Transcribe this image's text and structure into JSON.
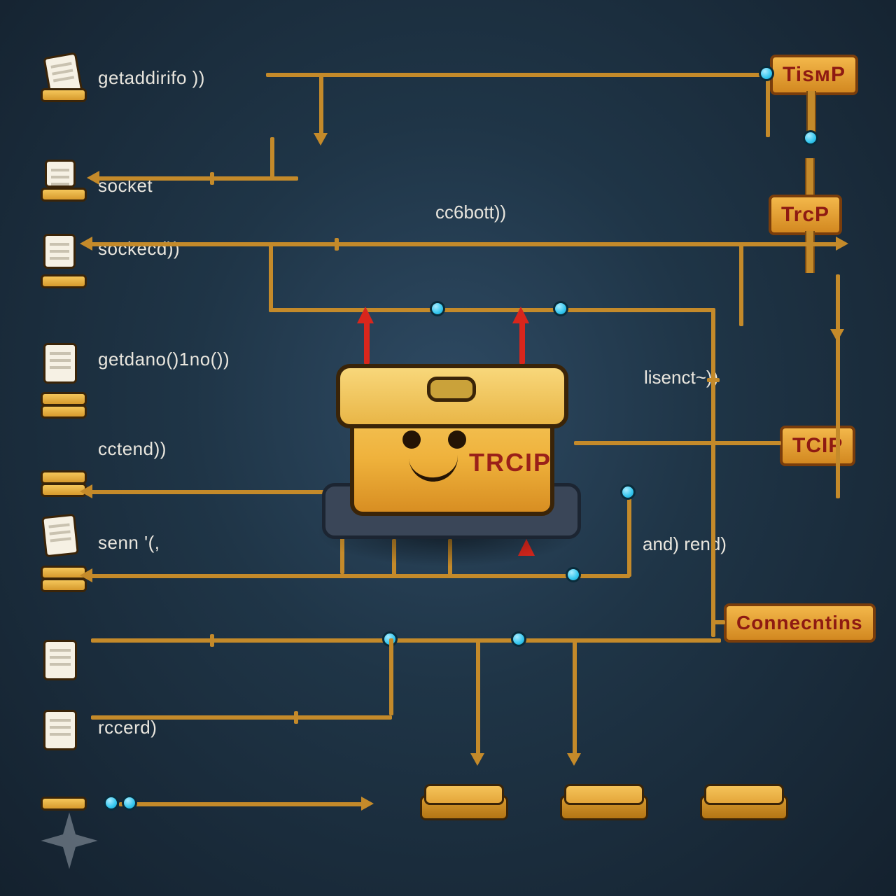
{
  "left_items": [
    {
      "label": "getaddirifo ))",
      "kind": "paper-stack"
    },
    {
      "label": "socket",
      "kind": "disc"
    },
    {
      "label": "sockecd))",
      "kind": "page-slab"
    },
    {
      "label": "getdano()1no())",
      "kind": "page-stack"
    },
    {
      "label": "cctend))",
      "kind": "stack"
    },
    {
      "label": "senn '(,",
      "kind": "paper-stack"
    },
    {
      "label": "",
      "kind": "page"
    },
    {
      "label": "rccerd)",
      "kind": "page"
    },
    {
      "label": "",
      "kind": "slab"
    }
  ],
  "mid_labels": {
    "top": "cc6bott))",
    "listen": "lisenct~))",
    "and_rend": "and)  rend)"
  },
  "signs": {
    "top": "TisᴍP",
    "second": "TrcP",
    "third": "TCIP",
    "connections": "Connecntins"
  },
  "mascot_brand": "TRCIP",
  "colors": {
    "line": "#c48a2a",
    "node": "#35c7ef",
    "sign_bg": "#f3b74a",
    "sign_text": "#8e1a12",
    "red": "#d9261c"
  }
}
